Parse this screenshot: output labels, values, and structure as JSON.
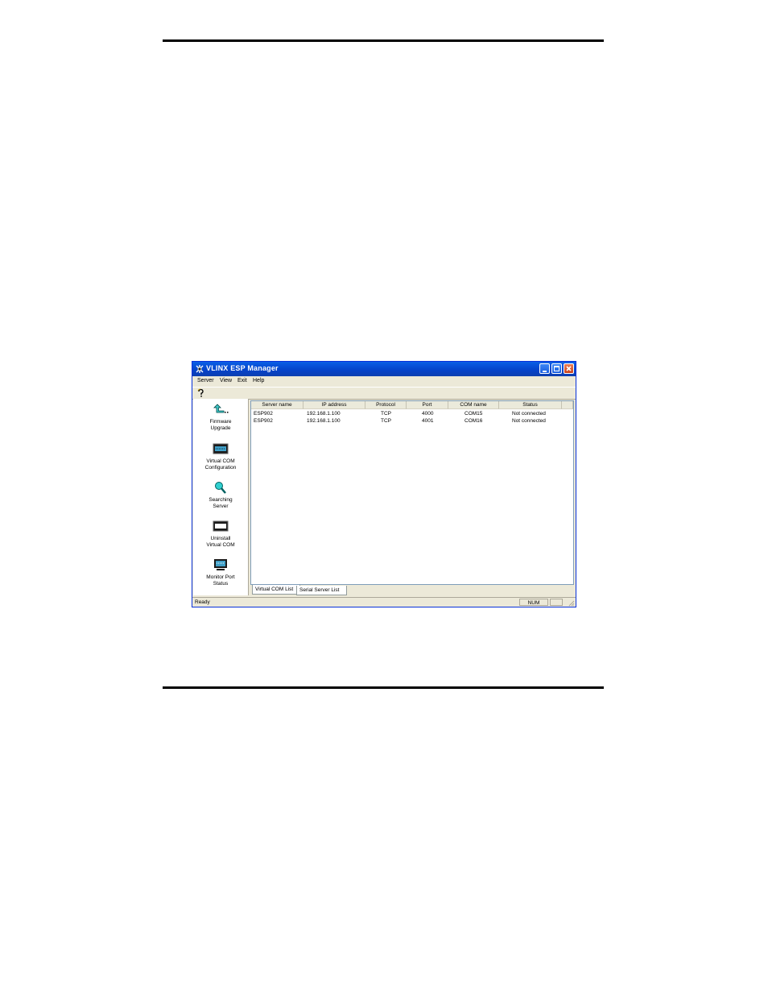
{
  "window": {
    "title": "VLINX ESP Manager",
    "accent": "#0a5fe6"
  },
  "menu": [
    "Server",
    "View",
    "Exit",
    "Help"
  ],
  "toolbar": {
    "help_icon": "help-question-icon"
  },
  "sidebar": [
    {
      "label_1": "Firmware",
      "label_2": "Upgrade",
      "icon": "firmware-upgrade-arrow-icon"
    },
    {
      "label_1": "Virtual COM",
      "label_2": "Configuration",
      "icon": "virtual-com-config-icon"
    },
    {
      "label_1": "Searching",
      "label_2": "Server",
      "icon": "search-magnifier-icon"
    },
    {
      "label_1": "Uninstall",
      "label_2": "Virtual COM",
      "icon": "uninstall-virtual-com-icon"
    },
    {
      "label_1": "Monitor Port",
      "label_2": "Status",
      "icon": "monitor-port-icon"
    }
  ],
  "list": {
    "columns": [
      "Server name",
      "IP address",
      "Protocol",
      "Port",
      "COM name",
      "Status"
    ],
    "rows": [
      [
        "ESP902",
        "192.168.1.100",
        "TCP",
        "4000",
        "COM15",
        "Not connected"
      ],
      [
        "ESP902",
        "192.168.1.100",
        "TCP",
        "4001",
        "COM16",
        "Not connected"
      ]
    ]
  },
  "tabs": [
    "Virtual COM List",
    "Serial Server List"
  ],
  "status": {
    "text": "Ready",
    "num": "NUM"
  }
}
